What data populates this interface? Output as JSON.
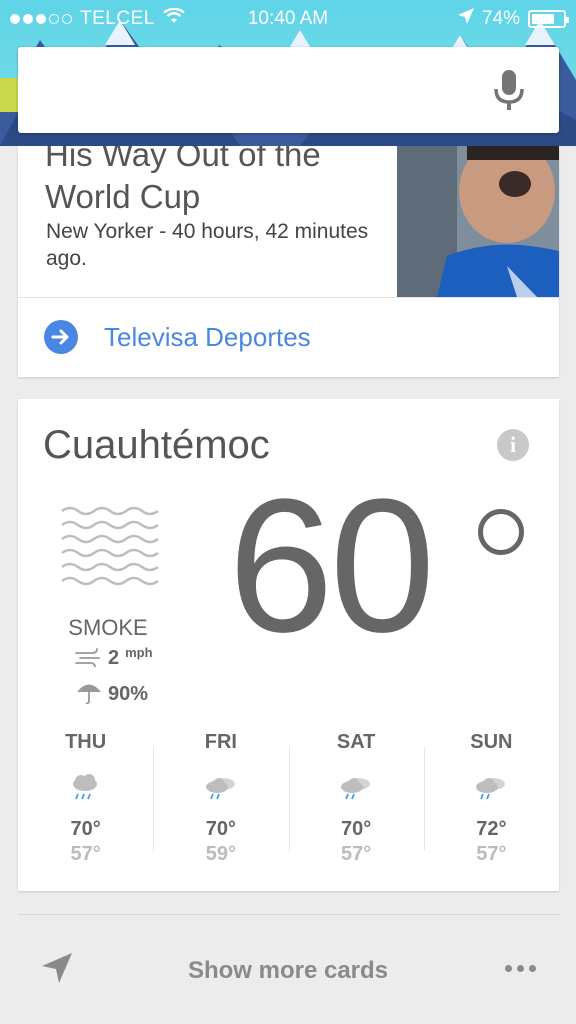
{
  "status_bar": {
    "carrier": "TELCEL",
    "time": "10:40 AM",
    "battery": "74%",
    "battery_level": 0.74,
    "signal_bars_filled": 3,
    "signal_bars_total": 5
  },
  "search": {
    "value": "",
    "mic_icon": "microphone-icon"
  },
  "news_card": {
    "headline": "His Way Out of the World Cup",
    "source_time": "New Yorker - 40 hours, 42 minutes ago.",
    "link_label": "Televisa Deportes",
    "link_icon": "arrow-right-icon"
  },
  "weather_card": {
    "location": "Cuauhtémoc",
    "temperature": "60",
    "condition": "SMOKE",
    "wind_speed": "2",
    "wind_unit": "mph",
    "rain_chance": "90%",
    "forecast": [
      {
        "day": "THU",
        "high": "70°",
        "low": "57°",
        "icon": "rain-cloud-icon"
      },
      {
        "day": "FRI",
        "high": "70°",
        "low": "59°",
        "icon": "partly-cloudy-rain-icon"
      },
      {
        "day": "SAT",
        "high": "70°",
        "low": "57°",
        "icon": "partly-cloudy-rain-icon"
      },
      {
        "day": "SUN",
        "high": "72°",
        "low": "57°",
        "icon": "partly-cloudy-rain-icon"
      }
    ]
  },
  "bottom_bar": {
    "show_more_label": "Show more cards"
  },
  "colors": {
    "accent_blue": "#4a87e3",
    "header_sky": "#5fd4e8",
    "text_gray": "#666666"
  }
}
